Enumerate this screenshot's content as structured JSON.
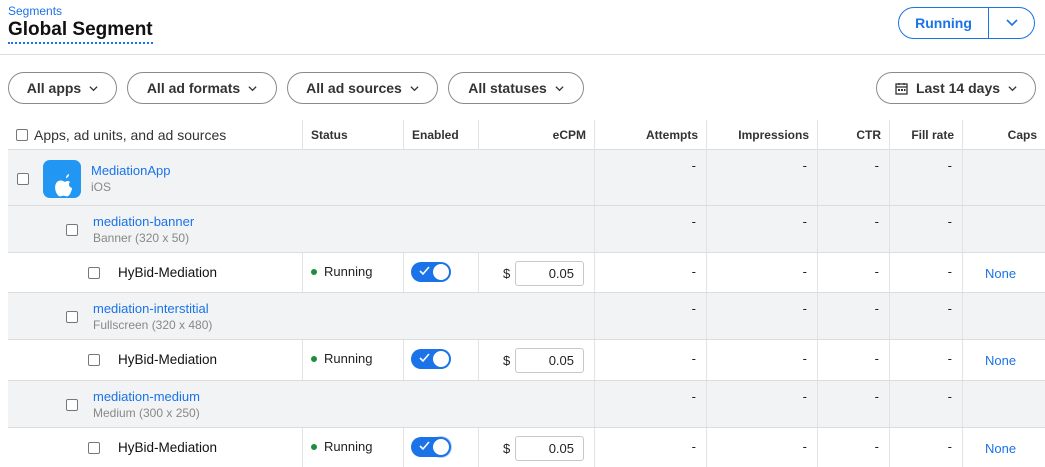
{
  "header": {
    "breadcrumb": "Segments",
    "title": "Global Segment",
    "status_button": "Running"
  },
  "filters": [
    {
      "label": "All apps"
    },
    {
      "label": "All ad formats"
    },
    {
      "label": "All ad sources"
    },
    {
      "label": "All statuses"
    }
  ],
  "date_range": "Last 14 days",
  "table": {
    "columns": [
      "Apps, ad units, and ad sources",
      "Status",
      "Enabled",
      "eCPM",
      "Attempts",
      "Impressions",
      "CTR",
      "Fill rate",
      "Caps"
    ],
    "rows": [
      {
        "type": "app",
        "name": "MediationApp",
        "subtitle": "iOS",
        "attempts": "-",
        "impressions": "-",
        "ctr": "-",
        "fill_rate": "-"
      },
      {
        "type": "ad_unit",
        "name": "mediation-banner",
        "subtitle": "Banner (320 x 50)",
        "attempts": "-",
        "impressions": "-",
        "ctr": "-",
        "fill_rate": "-"
      },
      {
        "type": "ad_source",
        "name": "HyBid-Mediation",
        "status": "Running",
        "currency": "$",
        "ecpm": "0.05",
        "attempts": "-",
        "impressions": "-",
        "ctr": "-",
        "fill_rate": "-",
        "caps": "None"
      },
      {
        "type": "ad_unit",
        "name": "mediation-interstitial",
        "subtitle": "Fullscreen (320 x 480)",
        "attempts": "-",
        "impressions": "-",
        "ctr": "-",
        "fill_rate": "-"
      },
      {
        "type": "ad_source",
        "name": "HyBid-Mediation",
        "status": "Running",
        "currency": "$",
        "ecpm": "0.05",
        "attempts": "-",
        "impressions": "-",
        "ctr": "-",
        "fill_rate": "-",
        "caps": "None"
      },
      {
        "type": "ad_unit",
        "name": "mediation-medium",
        "subtitle": "Medium (300 x 250)",
        "attempts": "-",
        "impressions": "-",
        "ctr": "-",
        "fill_rate": "-"
      },
      {
        "type": "ad_source",
        "name": "HyBid-Mediation",
        "status": "Running",
        "currency": "$",
        "ecpm": "0.05",
        "attempts": "-",
        "impressions": "-",
        "ctr": "-",
        "fill_rate": "-",
        "caps": "None"
      }
    ]
  },
  "icons": {
    "app": "apple-icon",
    "dropdown": "chevron-down-icon",
    "calendar": "calendar-icon",
    "toggle": "checkmark-icon"
  },
  "colors": {
    "accent": "#1a73e8",
    "running": "#1e8e3e",
    "app_icon": "#2196f3",
    "row_gray": "#f1f3f4"
  }
}
